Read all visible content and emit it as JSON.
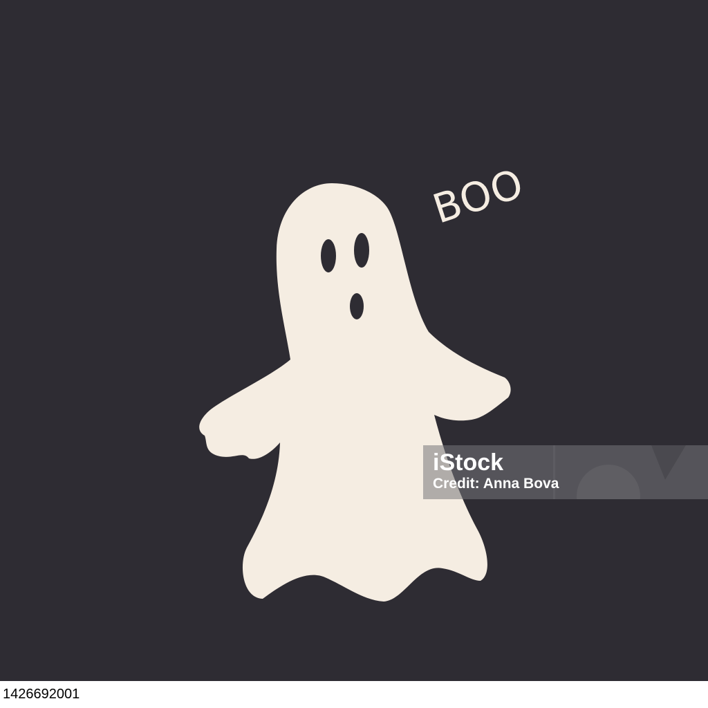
{
  "scene": {
    "background_color": "#2e2c33",
    "ghost_color": "#f5ede2",
    "feature_color": "#2e2c33",
    "boo_label": "BOO"
  },
  "watermark": {
    "logo_text": "iStock",
    "credit_text": "Credit: Anna Bova"
  },
  "footer": {
    "image_id": "1426692001"
  }
}
